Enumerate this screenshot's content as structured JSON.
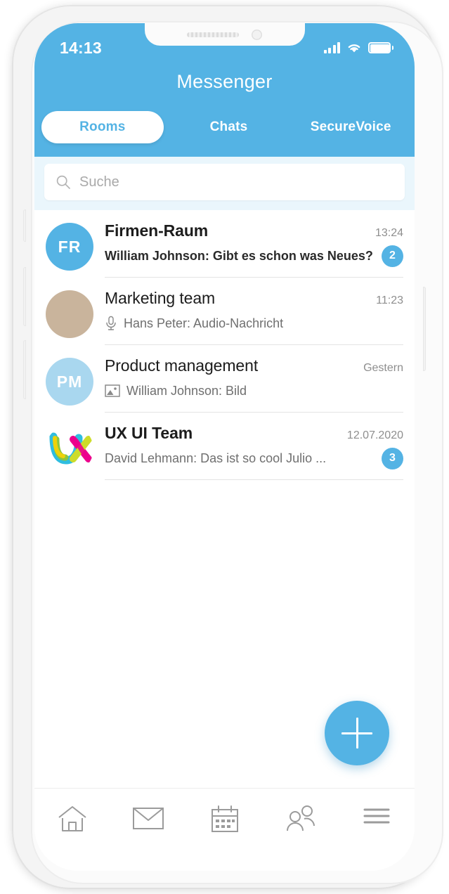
{
  "status_bar": {
    "time": "14:13",
    "signal_icon": "signal-bars-icon",
    "wifi_icon": "wifi-icon",
    "battery_icon": "battery-full-icon"
  },
  "header": {
    "title": "Messenger",
    "accent_color": "#54b3e4",
    "tabs": [
      {
        "label": "Rooms",
        "active": true
      },
      {
        "label": "Chats",
        "active": false
      },
      {
        "label": "SecureVoice",
        "active": false
      }
    ]
  },
  "search": {
    "placeholder": "Suche",
    "icon": "search-icon"
  },
  "rooms": [
    {
      "name": "Firmen-Raum",
      "avatar_initials": "FR",
      "avatar_color": "#54b3e4",
      "avatar_type": "initials",
      "preview": "William Johnson: Gibt es schon was Neues?",
      "preview_icon": "",
      "time": "13:24",
      "badge": "2",
      "unread": true
    },
    {
      "name": "Marketing team",
      "avatar_initials": "",
      "avatar_color": "",
      "avatar_type": "photo",
      "preview": "Hans Peter: Audio-Nachricht",
      "preview_icon": "microphone-icon",
      "time": "11:23",
      "badge": "",
      "unread": false
    },
    {
      "name": "Product management",
      "avatar_initials": "PM",
      "avatar_color": "#a9d7ef",
      "avatar_type": "initials",
      "preview": "William Johnson: Bild",
      "preview_icon": "image-icon",
      "time": "Gestern",
      "badge": "",
      "unread": false
    },
    {
      "name": "UX UI Team",
      "avatar_initials": "UX",
      "avatar_color": "",
      "avatar_type": "logo",
      "preview": "David Lehmann: Das ist so cool Julio ...",
      "preview_icon": "",
      "time": "12.07.2020",
      "badge": "3",
      "unread": true
    }
  ],
  "fab": {
    "icon": "plus-icon",
    "color": "#54b3e4"
  },
  "tabbar": [
    {
      "icon": "home-icon"
    },
    {
      "icon": "envelope-icon"
    },
    {
      "icon": "calendar-icon"
    },
    {
      "icon": "contacts-icon"
    },
    {
      "icon": "hamburger-menu-icon"
    }
  ]
}
